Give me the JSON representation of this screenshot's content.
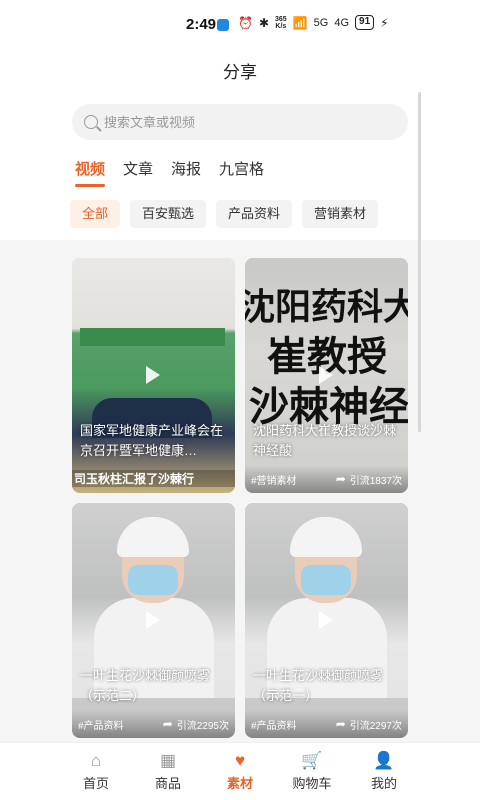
{
  "status_bar": {
    "time": "2:49",
    "speed_value": "365",
    "speed_unit": "K/s",
    "signal_a": "5G",
    "signal_b": "4G",
    "battery": "91"
  },
  "header": {
    "title": "分享"
  },
  "search": {
    "placeholder": "搜索文章或视频"
  },
  "tabs": [
    {
      "label": "视频",
      "active": true
    },
    {
      "label": "文章",
      "active": false
    },
    {
      "label": "海报",
      "active": false
    },
    {
      "label": "九宫格",
      "active": false
    }
  ],
  "filters": [
    {
      "label": "全部",
      "active": true
    },
    {
      "label": "百安甄选",
      "active": false
    },
    {
      "label": "产品资料",
      "active": false
    },
    {
      "label": "营销素材",
      "active": false
    }
  ],
  "cards": [
    {
      "title": "国家军地健康产业峰会在京召开暨军地健康…",
      "overlay_text": "司玉秋柱汇报了沙棘行",
      "tag": "",
      "share_text": ""
    },
    {
      "title": "沈阳药科大崔教授谈沙棘神经酸",
      "overlay_lines": [
        "沈阳药科大",
        "崔教授",
        "沙棘神经"
      ],
      "tag": "#营销素材",
      "share_text": "引流1837次"
    },
    {
      "title": "一叶生花沙棘御颜喷雾（示范二）",
      "tag": "#产品资料",
      "share_text": "引流2295次"
    },
    {
      "title": "一叶生花沙棘御颜喷雾（示范一）",
      "tag": "#产品资料",
      "share_text": "引流2297次"
    }
  ],
  "bottom_nav": [
    {
      "label": "首页",
      "icon": "home-icon",
      "active": false
    },
    {
      "label": "商品",
      "icon": "grid-icon",
      "active": false
    },
    {
      "label": "素材",
      "icon": "heart-hand-icon",
      "active": true
    },
    {
      "label": "购物车",
      "icon": "cart-icon",
      "active": false
    },
    {
      "label": "我的",
      "icon": "user-icon",
      "active": false
    }
  ],
  "colors": {
    "accent": "#e8642a"
  }
}
